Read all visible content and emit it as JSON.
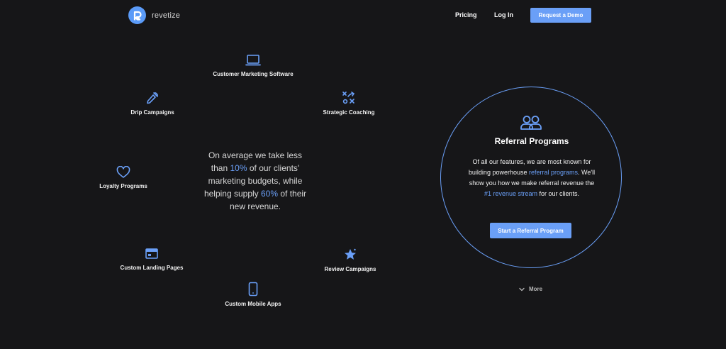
{
  "header": {
    "brand": "revetize",
    "nav": {
      "pricing": "Pricing",
      "login": "Log In"
    },
    "demo_button": "Request a Demo"
  },
  "features": {
    "customer_marketing": {
      "label": "Customer Marketing Software",
      "icon": "laptop-icon"
    },
    "drip": {
      "label": "Drip Campaigns",
      "icon": "dropper-icon"
    },
    "coaching": {
      "label": "Strategic Coaching",
      "icon": "strategy-icon"
    },
    "loyalty": {
      "label": "Loyalty Programs",
      "icon": "heart-icon"
    },
    "landing": {
      "label": "Custom Landing Pages",
      "icon": "browser-window-icon"
    },
    "reviews": {
      "label": "Review Campaigns",
      "icon": "star-sparkle-icon"
    },
    "mobile": {
      "label": "Custom Mobile Apps",
      "icon": "phone-icon"
    }
  },
  "statement": {
    "part1": "On average we take less than ",
    "highlight1": "10%",
    "part2": " of our clients' marketing budgets, while helping supply ",
    "highlight2": "60%",
    "part3": " of their new revenue."
  },
  "referral": {
    "icon": "users-icon",
    "title": "Referral Programs",
    "body_part1": "Of all our features, we are most known for building powerhouse ",
    "body_link1": "referral programs",
    "body_part2": ". We'll show you how we make referral revenue the ",
    "body_link2": "#1 revenue stream",
    "body_part3": " for our clients.",
    "cta": "Start a Referral Program"
  },
  "more": {
    "label": "More",
    "icon": "chevron-down-icon"
  },
  "colors": {
    "accent": "#6a9ff7",
    "background": "#161618",
    "text": "#ffffff"
  }
}
